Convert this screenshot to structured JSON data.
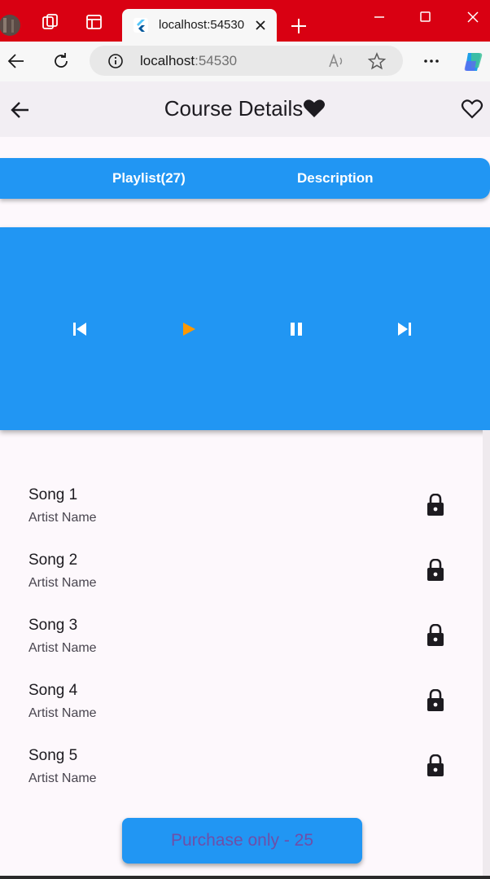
{
  "browser": {
    "tab_title": "localhost:54530",
    "url_host": "localhost",
    "url_port": ":54530"
  },
  "appbar": {
    "title": "Course Details"
  },
  "tabs": [
    {
      "label": "Playlist(27)"
    },
    {
      "label": "Description"
    }
  ],
  "player": {
    "play_icon_color": "#ff9800",
    "background": "#2196f3"
  },
  "songs": [
    {
      "title": "Song 1",
      "artist": "Artist Name",
      "locked": true
    },
    {
      "title": "Song 2",
      "artist": "Artist Name",
      "locked": true
    },
    {
      "title": "Song 3",
      "artist": "Artist Name",
      "locked": true
    },
    {
      "title": "Song 4",
      "artist": "Artist Name",
      "locked": true
    },
    {
      "title": "Song 5",
      "artist": "Artist Name",
      "locked": true
    }
  ],
  "purchase": {
    "label": "Purchase only - 25"
  }
}
